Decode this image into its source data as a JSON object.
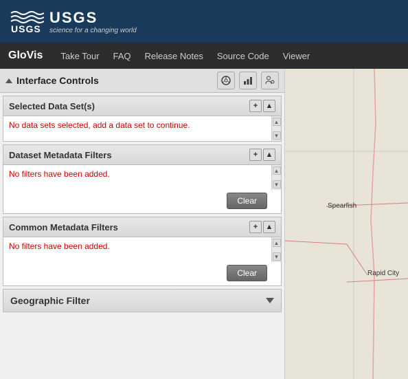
{
  "header": {
    "brand": "USGS",
    "tagline": "science for a changing world"
  },
  "nav": {
    "brand": "GloVis",
    "links": [
      "Take Tour",
      "FAQ",
      "Release Notes",
      "Source Code",
      "Viewer"
    ]
  },
  "interface_controls": {
    "title": "Interface Controls",
    "icons": [
      "steering-wheel",
      "chart",
      "person-gear"
    ]
  },
  "selected_datasets": {
    "title": "Selected Data Set(s)",
    "empty_message": "No data sets selected, add a data set to continue."
  },
  "dataset_metadata": {
    "title": "Dataset Metadata Filters",
    "empty_message": "No filters have been added.",
    "clear_label": "Clear"
  },
  "common_metadata": {
    "title": "Common Metadata Filters",
    "empty_message": "No filters have been added.",
    "clear_label": "Clear"
  },
  "geographic_filter": {
    "title": "Geographic Filter"
  },
  "map": {
    "location_label": "Spearfish",
    "location2_label": "Rapid City"
  }
}
